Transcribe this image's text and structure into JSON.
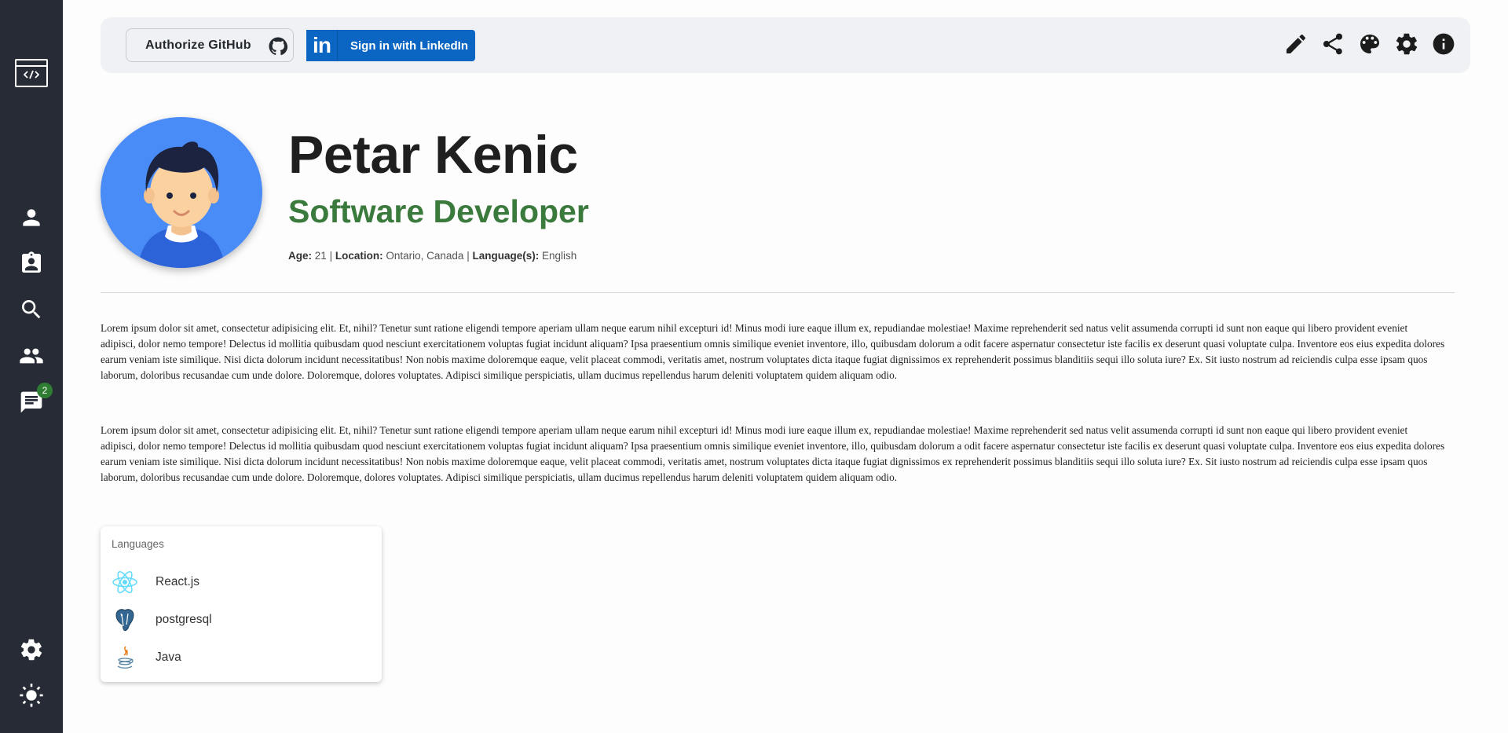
{
  "sidebar": {
    "logo_icon": "code-window-icon",
    "items": [
      {
        "name": "profile",
        "icon": "person-icon"
      },
      {
        "name": "resume",
        "icon": "badge-clipboard-icon"
      },
      {
        "name": "search",
        "icon": "search-icon"
      },
      {
        "name": "people",
        "icon": "group-icon"
      },
      {
        "name": "messages",
        "icon": "chat-icon",
        "badge": "2"
      }
    ],
    "bottom": [
      {
        "name": "settings",
        "icon": "gear-icon"
      },
      {
        "name": "theme",
        "icon": "sun-icon"
      }
    ]
  },
  "topbar": {
    "github_label": "Authorize GitHub",
    "linkedin_logo": "in",
    "linkedin_label": "Sign in with LinkedIn",
    "icons": [
      "edit-icon",
      "share-icon",
      "palette-icon",
      "gear-icon",
      "info-icon"
    ]
  },
  "profile": {
    "name": "Petar Kenic",
    "title": "Software Developer",
    "age_label": "Age:",
    "age": "21",
    "location_label": "Location:",
    "location": "Ontario, Canada",
    "languages_label": "Language(s):",
    "languages": "English",
    "separator": "|"
  },
  "bio": {
    "paragraph1": "Lorem ipsum dolor sit amet, consectetur adipisicing elit. Et, nihil? Tenetur sunt ratione eligendi tempore aperiam ullam neque earum nihil excepturi id! Minus modi iure eaque illum ex, repudiandae molestiae! Maxime reprehenderit sed natus velit assumenda corrupti id sunt non eaque qui libero provident eveniet adipisci, dolor nemo tempore! Delectus id mollitia quibusdam quod nesciunt exercitationem voluptas fugiat incidunt aliquam? Ipsa praesentium omnis similique eveniet inventore, illo, quibusdam dolorum a odit facere aspernatur consectetur iste facilis ex deserunt quasi voluptate culpa. Inventore eos eius expedita dolores earum veniam iste similique. Nisi dicta dolorum incidunt necessitatibus! Non nobis maxime doloremque eaque, velit placeat commodi, veritatis amet, nostrum voluptates dicta itaque fugiat dignissimos ex reprehenderit possimus blanditiis sequi illo soluta iure? Ex. Sit iusto nostrum ad reiciendis culpa esse ipsam quos laborum, doloribus recusandae cum unde dolore. Doloremque, dolores voluptates. Adipisci similique perspiciatis, ullam ducimus repellendus harum deleniti voluptatem quidem aliquam odio.",
    "paragraph2": "Lorem ipsum dolor sit amet, consectetur adipisicing elit. Et, nihil? Tenetur sunt ratione eligendi tempore aperiam ullam neque earum nihil excepturi id! Minus modi iure eaque illum ex, repudiandae molestiae! Maxime reprehenderit sed natus velit assumenda corrupti id sunt non eaque qui libero provident eveniet adipisci, dolor nemo tempore! Delectus id mollitia quibusdam quod nesciunt exercitationem voluptas fugiat incidunt aliquam? Ipsa praesentium omnis similique eveniet inventore, illo, quibusdam dolorum a odit facere aspernatur consectetur iste facilis ex deserunt quasi voluptate culpa. Inventore eos eius expedita dolores earum veniam iste similique. Nisi dicta dolorum incidunt necessitatibus! Non nobis maxime doloremque eaque, velit placeat commodi, veritatis amet, nostrum voluptates dicta itaque fugiat dignissimos ex reprehenderit possimus blanditiis sequi illo soluta iure? Ex. Sit iusto nostrum ad reiciendis culpa esse ipsam quos laborum, doloribus recusandae cum unde dolore. Doloremque, dolores voluptates. Adipisci similique perspiciatis, ullam ducimus repellendus harum deleniti voluptatem quidem aliquam odio."
  },
  "languages_card": {
    "title": "Languages",
    "items": [
      {
        "label": "React.js",
        "icon": "react-icon"
      },
      {
        "label": "postgresql",
        "icon": "postgresql-icon"
      },
      {
        "label": "Java",
        "icon": "java-icon"
      }
    ]
  },
  "colors": {
    "sidebar_bg": "#262b35",
    "title_green": "#3a7a3c",
    "linkedin_blue": "#0a66c2",
    "avatar_bg": "#4a8cf7"
  }
}
